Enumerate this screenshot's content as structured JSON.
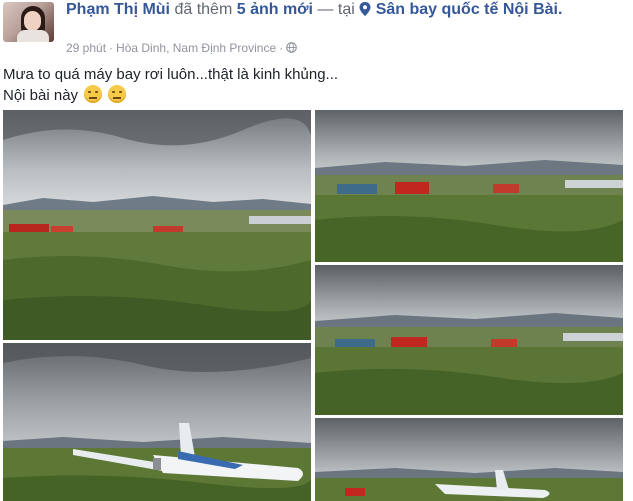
{
  "post": {
    "author": "Phạm Thị Mùi",
    "action_prefix": "đã thêm",
    "photo_count": "5 ảnh mới",
    "separator": "— tại",
    "place": "Sân bay quốc tế Nội Bài.",
    "time": "29 phút",
    "location": "Hòa Dinh, Nam Định Province",
    "caption_line1": "Mưa to quá máy bay rơi luôn...thật là kinh khủng...",
    "caption_line2": "Nội bài này"
  },
  "icons": {
    "pin": "map-pin-icon",
    "globe": "globe-icon",
    "emoji": "confused-face-emoji"
  },
  "colors": {
    "name": "#365899",
    "meta": "#90949c",
    "text": "#1d2129"
  },
  "photos": [
    {
      "scene": "runway-field-fire-trucks"
    },
    {
      "scene": "runway-field-fire-trucks"
    },
    {
      "scene": "runway-field-fire-trucks"
    },
    {
      "scene": "airplane-in-grass"
    },
    {
      "scene": "airplane-in-grass"
    }
  ]
}
